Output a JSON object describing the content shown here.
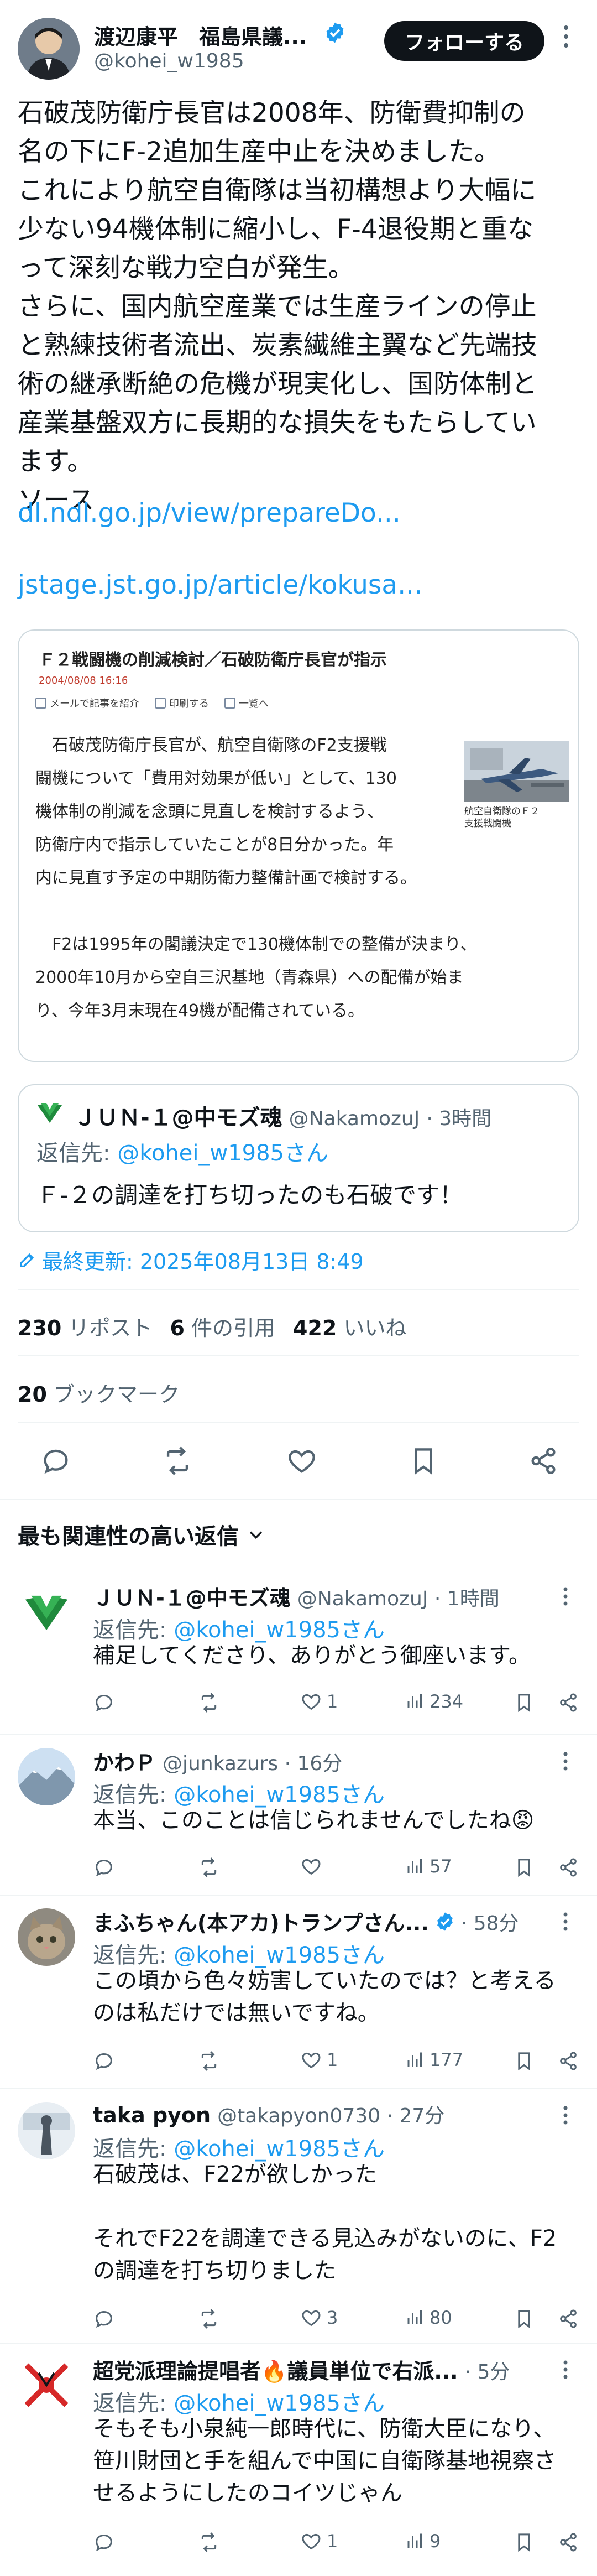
{
  "author": {
    "name": "渡辺康平　福島県議...",
    "handle": "@kohei_w1985",
    "follow_label": "フォローする"
  },
  "tweet": {
    "lines": [
      "石破茂防衛庁長官は2008年、防衛費抑制の",
      "名の下にF-2追加生産中止を決めました。",
      "これにより航空自衛隊は当初構想より大幅に",
      "少ない94機体制に縮小し、F-4退役期と重な",
      "って深刻な戦力空白が発生。",
      "さらに、国内航空産業では生産ラインの停止",
      "と熟練技術者流出、炭素繊維主翼など先端技",
      "術の継承断絶の危機が現実化し、国防体制と",
      "産業基盤双方に長期的な損失をもたらしてい",
      "ます。",
      "ソース"
    ],
    "link1": "dl.ndl.go.jp/view/prepareDo...",
    "link2": "jstage.jst.go.jp/article/kokusa..."
  },
  "article": {
    "title": "Ｆ２戦闘機の削減検討／石破防衛庁長官が指示",
    "date": "2004/08/08 16:16",
    "tools": [
      "メールで記事を紹介",
      "印刷する",
      "一覧へ"
    ],
    "body_lines": [
      "　石破茂防衛庁長官が、航空自衛隊のF2支援戦",
      "闘機について「費用対効果が低い」として、130",
      "機体制の削減を念頭に見直しを検討するよう、",
      "防衛庁内で指示していたことが8日分かった。年",
      "内に見直す予定の中期防衛力整備計画で検討する。",
      "",
      "　F2は1995年の閣議決定で130機体制での整備が決まり、",
      "2000年10月から空自三沢基地（青森県）への配備が始ま",
      "り、今年3月末現在49機が配備されている。"
    ],
    "photo_caption": "航空自衛隊のＦ２\n支援戦闘機"
  },
  "quote": {
    "name": "ＪＵＮ-１@中モズ魂",
    "handle": "@NakamozuJ",
    "time": "· 3時間",
    "reply_prefix": "返信先: ",
    "reply_handle": "@kohei_w1985さん",
    "text": "Ｆ-２の調達を打ち切ったのも石破です！"
  },
  "updated": "最終更新: 2025年08月13日 8:49",
  "stats": {
    "reposts_num": "230",
    "reposts_label": "リポスト",
    "quotes_num": "6",
    "quotes_label": "件の引用",
    "likes_num": "422",
    "likes_label": "いいね",
    "bookmarks_num": "20",
    "bookmarks_label": "ブックマーク"
  },
  "replies_header": "最も関連性の高い返信",
  "replies": [
    {
      "name": "ＪＵＮ-１@中モズ魂",
      "meta": "@NakamozuJ · 1時間",
      "reply_prefix": "返信先: ",
      "reply_handle": "@kohei_w1985さん",
      "text_lines": [
        "補足してくださり、ありがとう御座います。"
      ],
      "likes": "1",
      "views": "234"
    },
    {
      "name": "かわＰ",
      "meta": "@junkazurs · 16分",
      "reply_prefix": "返信先: ",
      "reply_handle": "@kohei_w1985さん",
      "text_lines": [
        "本当、このことは信じられませんでしたね😡"
      ],
      "likes": "",
      "views": "57"
    },
    {
      "name": "まふちゃん(本アカ)トランプさん...",
      "meta": "· 58分",
      "reply_prefix": "返信先: ",
      "reply_handle": "@kohei_w1985さん",
      "text_lines": [
        "この頃から色々妨害していたのでは？と考える",
        "のは私だけでは無いですね。"
      ],
      "likes": "1",
      "views": "177"
    },
    {
      "name": "taka pyon",
      "meta": "@takapyon0730 · 27分",
      "reply_prefix": "返信先: ",
      "reply_handle": "@kohei_w1985さん",
      "text_lines": [
        "石破茂は、F22が欲しかった",
        "",
        "それでF22を調達できる見込みがないのに、F2",
        "の調達を打ち切りました"
      ],
      "likes": "3",
      "views": "80"
    },
    {
      "name": "超党派理論提唱者🔥議員単位で右派...",
      "meta": "· 5分",
      "reply_prefix": "返信先: ",
      "reply_handle": "@kohei_w1985さん",
      "text_lines": [
        "そもそも小泉純一郎時代に、防衛大臣になり、",
        "笹川財団と手を組んで中国に自衛隊基地視察さ",
        "せるようにしたのコイツじゃん"
      ],
      "likes": "1",
      "views": "9"
    }
  ],
  "colors": {
    "accent": "#1d9bf0",
    "text": "#0f1419",
    "secondary": "#536471",
    "border": "#cfd9de"
  }
}
